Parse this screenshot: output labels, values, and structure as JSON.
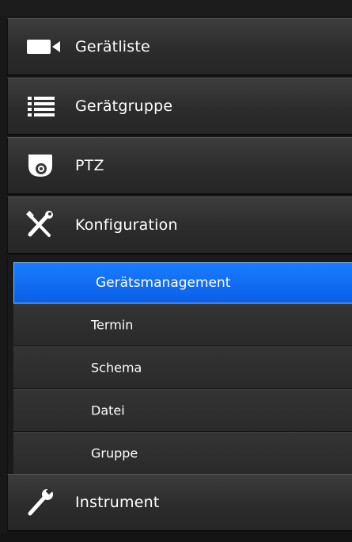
{
  "nav": {
    "items": [
      {
        "label": "Gerätliste",
        "icon": "video-camera-icon"
      },
      {
        "label": "Gerätgruppe",
        "icon": "list-icon"
      },
      {
        "label": "PTZ",
        "icon": "dome-camera-icon"
      },
      {
        "label": "Konfiguration",
        "icon": "tools-icon"
      },
      {
        "label": "Instrument",
        "icon": "wrench-icon"
      }
    ],
    "submenu": {
      "parent": "Konfiguration",
      "selected": "Gerätsmanagement",
      "items": [
        {
          "label": "Gerätsmanagement"
        },
        {
          "label": "Termin"
        },
        {
          "label": "Schema"
        },
        {
          "label": "Datei"
        },
        {
          "label": "Gruppe"
        }
      ]
    }
  },
  "colors": {
    "selected_bg": "#0f6cf5",
    "item_bg": "#2e2e2e",
    "text": "#ffffff"
  }
}
